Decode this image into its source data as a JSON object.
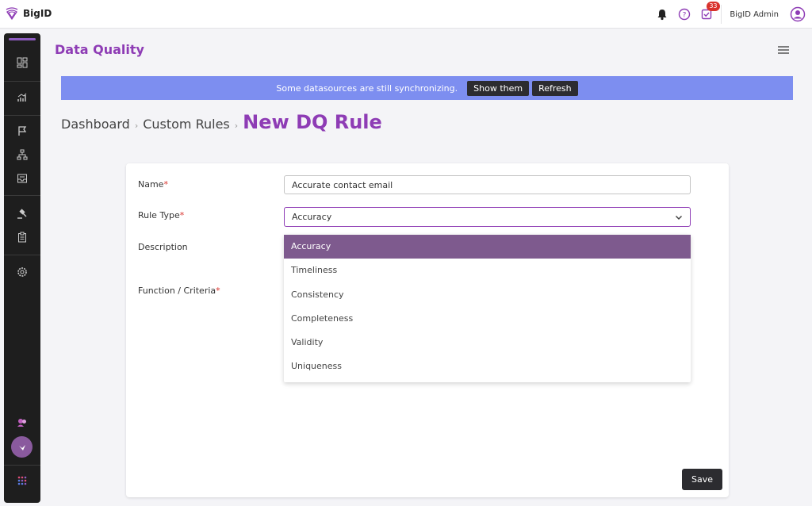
{
  "topbar": {
    "brand": "BigID",
    "notification_count": "33",
    "user_name": "BigID Admin"
  },
  "colors": {
    "accent": "#8e3cb5",
    "banner": "#7d8ef0",
    "selected_option": "#7e5a8e",
    "dark_button": "#2c2c30"
  },
  "sidebar": {
    "icons": [
      "dashboard-icon",
      "reports-icon",
      "flag-icon",
      "hierarchy-icon",
      "inbox-icon",
      "gavel-icon",
      "clipboard-icon",
      "settings-icon",
      "users-icon",
      "apps-grid-icon"
    ]
  },
  "header": {
    "title": "Data Quality"
  },
  "banner": {
    "message": "Some datasources are still synchronizing.",
    "show_label": "Show them",
    "refresh_label": "Refresh"
  },
  "breadcrumb": {
    "items": [
      "Dashboard",
      "Custom Rules"
    ],
    "current": "New DQ Rule"
  },
  "form": {
    "name_label": "Name",
    "name_value": "Accurate contact email",
    "rule_type_label": "Rule Type",
    "rule_type_value": "Accuracy",
    "description_label": "Description",
    "function_label": "Function / Criteria",
    "required_mark": "*",
    "rule_type_options": [
      "Accuracy",
      "Timeliness",
      "Consistency",
      "Completeness",
      "Validity",
      "Uniqueness"
    ],
    "save_label": "Save"
  }
}
